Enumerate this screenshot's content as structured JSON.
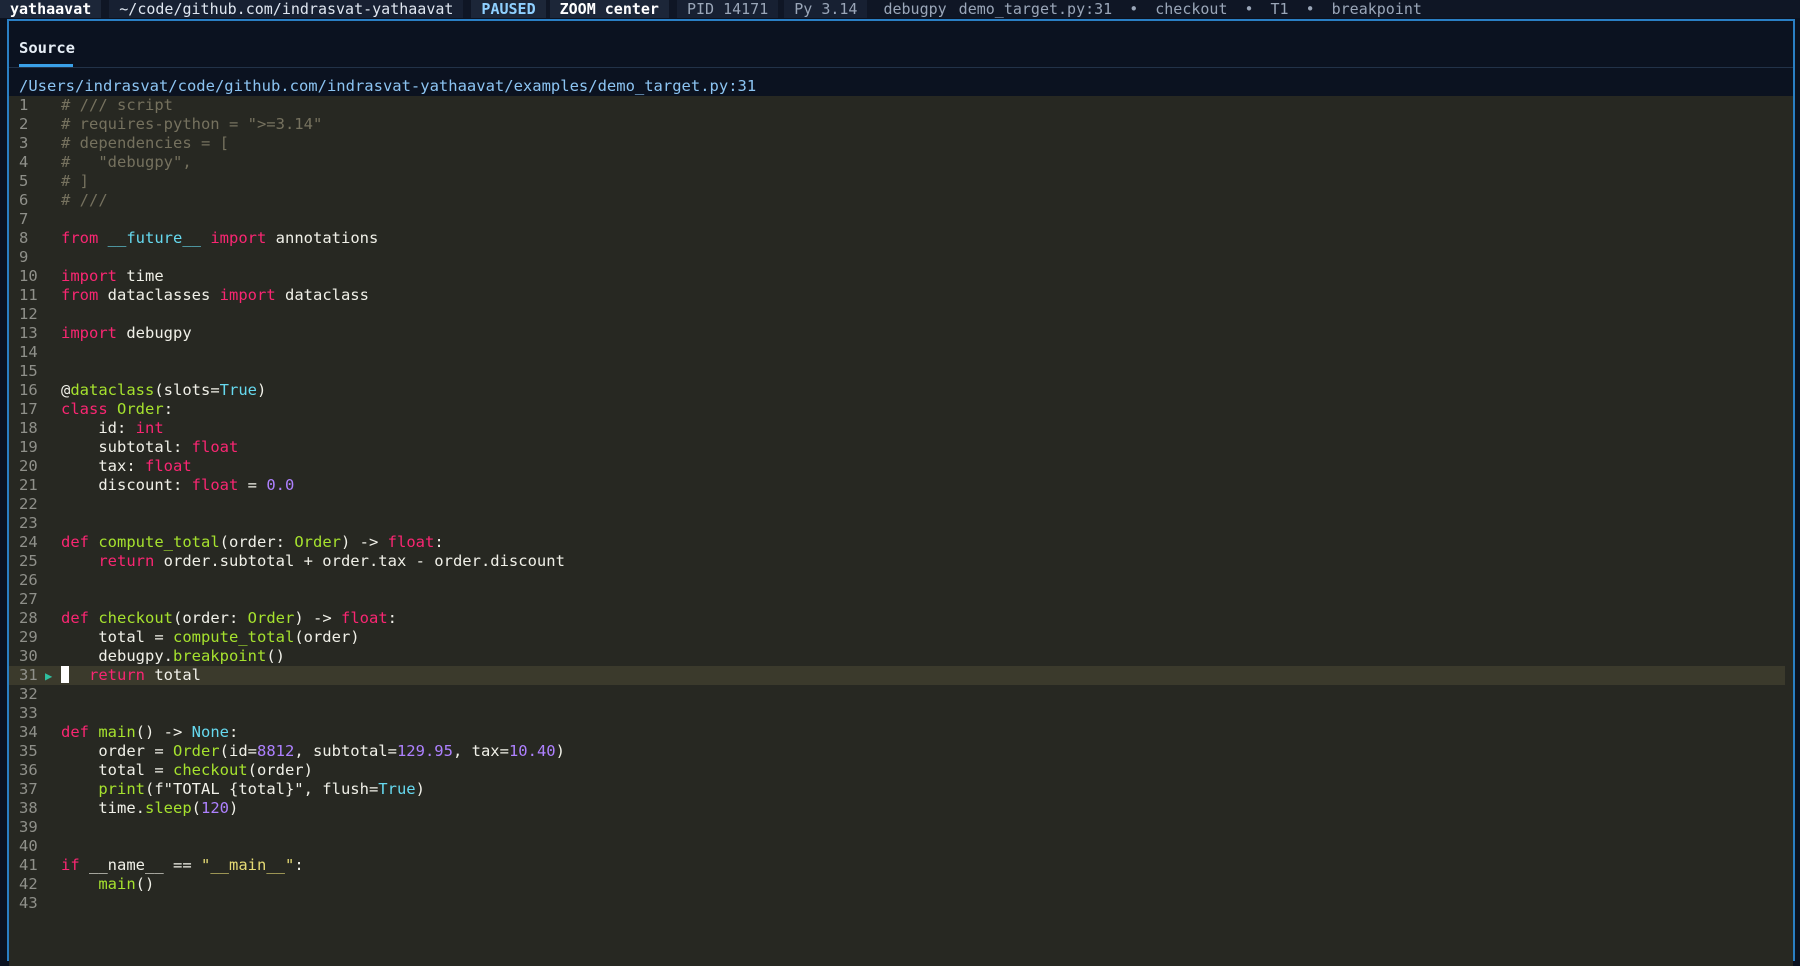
{
  "statusbar": {
    "host": "yathaavat",
    "path": "~/code/github.com/indrasvat-yathaavat",
    "state": "PAUSED",
    "zoom": "ZOOM center",
    "pid": "PID 14171",
    "python": "Py 3.14",
    "adapter": "debugpy",
    "location": "demo_target.py:31",
    "separator": "•",
    "function": "checkout",
    "thread": "T1",
    "reason": "breakpoint"
  },
  "panel": {
    "tab_label": "Source",
    "file_path": "/Users/indrasvat/code/github.com/indrasvat-yathaavat/examples/demo_target.py:31",
    "current_line": 31
  },
  "colors": {
    "accent": "#2a7fc4",
    "editor_bg": "#272822",
    "current_line_bg": "#3b3a2c"
  },
  "icons": {
    "current_line": "play-arrow-icon"
  },
  "code_lines": [
    {
      "n": "1",
      "tokens": [
        [
          "comment",
          "# /// script"
        ]
      ]
    },
    {
      "n": "2",
      "tokens": [
        [
          "comment",
          "# requires-python = \">=3.14\""
        ]
      ]
    },
    {
      "n": "3",
      "tokens": [
        [
          "comment",
          "# dependencies = ["
        ]
      ]
    },
    {
      "n": "4",
      "tokens": [
        [
          "comment",
          "#   \"debugpy\","
        ]
      ]
    },
    {
      "n": "5",
      "tokens": [
        [
          "comment",
          "# ]"
        ]
      ]
    },
    {
      "n": "6",
      "tokens": [
        [
          "comment",
          "# ///"
        ]
      ]
    },
    {
      "n": "7",
      "tokens": []
    },
    {
      "n": "8",
      "tokens": [
        [
          "kw",
          "from"
        ],
        [
          "plain",
          " "
        ],
        [
          "mod",
          "__future__"
        ],
        [
          "plain",
          " "
        ],
        [
          "kw",
          "import"
        ],
        [
          "plain",
          " annotations"
        ]
      ]
    },
    {
      "n": "9",
      "tokens": []
    },
    {
      "n": "10",
      "tokens": [
        [
          "kw",
          "import"
        ],
        [
          "plain",
          " time"
        ]
      ]
    },
    {
      "n": "11",
      "tokens": [
        [
          "kw",
          "from"
        ],
        [
          "plain",
          " dataclasses "
        ],
        [
          "kw",
          "import"
        ],
        [
          "plain",
          " dataclass"
        ]
      ]
    },
    {
      "n": "12",
      "tokens": []
    },
    {
      "n": "13",
      "tokens": [
        [
          "kw",
          "import"
        ],
        [
          "plain",
          " debugpy"
        ]
      ]
    },
    {
      "n": "14",
      "tokens": []
    },
    {
      "n": "15",
      "tokens": []
    },
    {
      "n": "16",
      "tokens": [
        [
          "plain",
          "@"
        ],
        [
          "fn",
          "dataclass"
        ],
        [
          "plain",
          "(slots="
        ],
        [
          "const",
          "True"
        ],
        [
          "plain",
          ")"
        ]
      ]
    },
    {
      "n": "17",
      "tokens": [
        [
          "kw",
          "class"
        ],
        [
          "plain",
          " "
        ],
        [
          "cls",
          "Order"
        ],
        [
          "plain",
          ":"
        ]
      ]
    },
    {
      "n": "18",
      "tokens": [
        [
          "plain",
          "    id: "
        ],
        [
          "type",
          "int"
        ]
      ]
    },
    {
      "n": "19",
      "tokens": [
        [
          "plain",
          "    subtotal: "
        ],
        [
          "type",
          "float"
        ]
      ]
    },
    {
      "n": "20",
      "tokens": [
        [
          "plain",
          "    tax: "
        ],
        [
          "type",
          "float"
        ]
      ]
    },
    {
      "n": "21",
      "tokens": [
        [
          "plain",
          "    discount: "
        ],
        [
          "type",
          "float"
        ],
        [
          "plain",
          " = "
        ],
        [
          "num",
          "0.0"
        ]
      ]
    },
    {
      "n": "22",
      "tokens": []
    },
    {
      "n": "23",
      "tokens": []
    },
    {
      "n": "24",
      "tokens": [
        [
          "kw",
          "def"
        ],
        [
          "plain",
          " "
        ],
        [
          "fn",
          "compute_total"
        ],
        [
          "plain",
          "(order: "
        ],
        [
          "cls",
          "Order"
        ],
        [
          "plain",
          ") -> "
        ],
        [
          "type",
          "float"
        ],
        [
          "plain",
          ":"
        ]
      ]
    },
    {
      "n": "25",
      "tokens": [
        [
          "plain",
          "    "
        ],
        [
          "kw",
          "return"
        ],
        [
          "plain",
          " order.subtotal + order.tax - order.discount"
        ]
      ]
    },
    {
      "n": "26",
      "tokens": []
    },
    {
      "n": "27",
      "tokens": []
    },
    {
      "n": "28",
      "tokens": [
        [
          "kw",
          "def"
        ],
        [
          "plain",
          " "
        ],
        [
          "fn",
          "checkout"
        ],
        [
          "plain",
          "(order: "
        ],
        [
          "cls",
          "Order"
        ],
        [
          "plain",
          ") -> "
        ],
        [
          "type",
          "float"
        ],
        [
          "plain",
          ":"
        ]
      ]
    },
    {
      "n": "29",
      "tokens": [
        [
          "plain",
          "    total = "
        ],
        [
          "fn",
          "compute_total"
        ],
        [
          "plain",
          "(order)"
        ]
      ]
    },
    {
      "n": "30",
      "tokens": [
        [
          "plain",
          "    debugpy."
        ],
        [
          "fn",
          "breakpoint"
        ],
        [
          "plain",
          "()"
        ]
      ]
    },
    {
      "n": "31",
      "tokens": [
        [
          "kw",
          "return"
        ],
        [
          "plain",
          " total"
        ]
      ],
      "current": true
    },
    {
      "n": "32",
      "tokens": []
    },
    {
      "n": "33",
      "tokens": []
    },
    {
      "n": "34",
      "tokens": [
        [
          "kw",
          "def"
        ],
        [
          "plain",
          " "
        ],
        [
          "fn",
          "main"
        ],
        [
          "plain",
          "() -> "
        ],
        [
          "const",
          "None"
        ],
        [
          "plain",
          ":"
        ]
      ]
    },
    {
      "n": "35",
      "tokens": [
        [
          "plain",
          "    order = "
        ],
        [
          "cls",
          "Order"
        ],
        [
          "plain",
          "(id="
        ],
        [
          "num",
          "8812"
        ],
        [
          "plain",
          ", subtotal="
        ],
        [
          "num",
          "129.95"
        ],
        [
          "plain",
          ", tax="
        ],
        [
          "num",
          "10.40"
        ],
        [
          "plain",
          ")"
        ]
      ]
    },
    {
      "n": "36",
      "tokens": [
        [
          "plain",
          "    total = "
        ],
        [
          "fn",
          "checkout"
        ],
        [
          "plain",
          "(order)"
        ]
      ]
    },
    {
      "n": "37",
      "tokens": [
        [
          "plain",
          "    "
        ],
        [
          "fn",
          "print"
        ],
        [
          "plain",
          "(f\"TOTAL {total}\", flush="
        ],
        [
          "const",
          "True"
        ],
        [
          "plain",
          ")"
        ]
      ]
    },
    {
      "n": "38",
      "tokens": [
        [
          "plain",
          "    time."
        ],
        [
          "fn",
          "sleep"
        ],
        [
          "plain",
          "("
        ],
        [
          "num",
          "120"
        ],
        [
          "plain",
          ")"
        ]
      ]
    },
    {
      "n": "39",
      "tokens": []
    },
    {
      "n": "40",
      "tokens": []
    },
    {
      "n": "41",
      "tokens": [
        [
          "kw",
          "if"
        ],
        [
          "plain",
          " __name__ == "
        ],
        [
          "str",
          "\"__main__\""
        ],
        [
          "plain",
          ":"
        ]
      ]
    },
    {
      "n": "42",
      "tokens": [
        [
          "plain",
          "    "
        ],
        [
          "fn",
          "main"
        ],
        [
          "plain",
          "()"
        ]
      ]
    },
    {
      "n": "43",
      "tokens": []
    }
  ]
}
